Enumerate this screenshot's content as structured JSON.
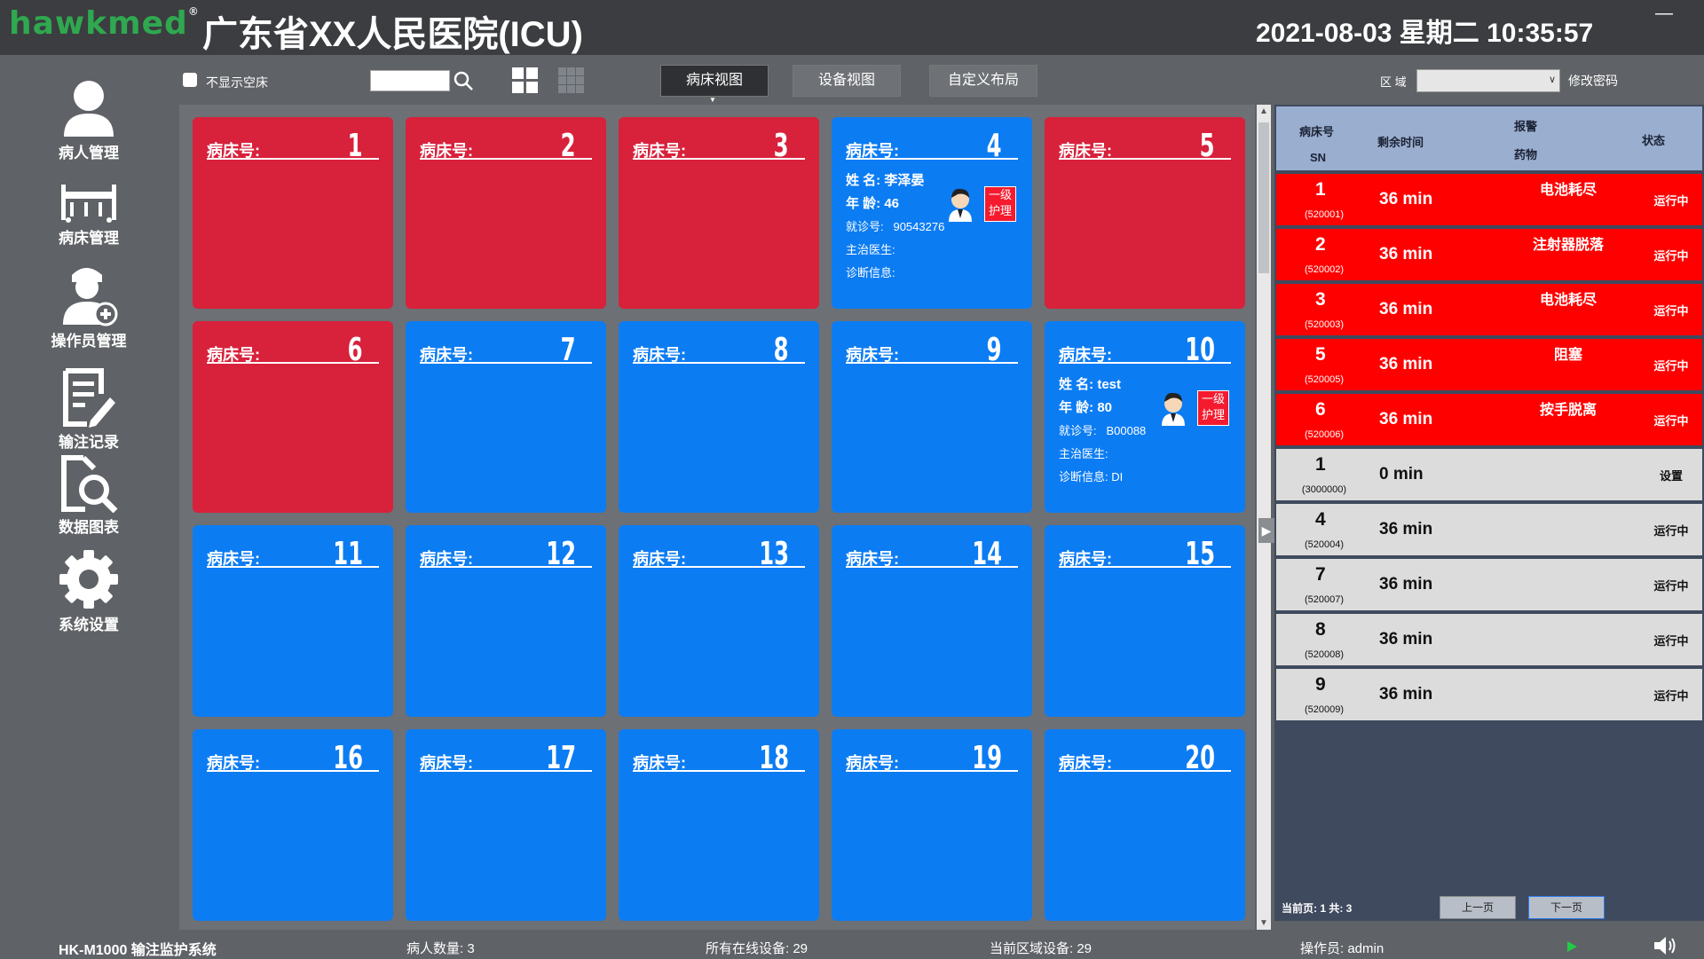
{
  "app": {
    "logo": "hawkmed",
    "title": "广东省XX人民医院(ICU)",
    "datetime": "2021-08-03  星期二  10:35:57"
  },
  "sidebar": {
    "items": [
      {
        "label": "病人管理",
        "icon": "patient-icon"
      },
      {
        "label": "病床管理",
        "icon": "bed-icon"
      },
      {
        "label": "操作员管理",
        "icon": "operator-add-icon"
      },
      {
        "label": "输注记录",
        "icon": "record-edit-icon"
      },
      {
        "label": "数据图表",
        "icon": "data-search-icon"
      },
      {
        "label": "系统设置",
        "icon": "gear-icon"
      }
    ]
  },
  "toolbar": {
    "hide_empty_label": "不显示空床",
    "search_value": "",
    "tabs": [
      "病床视图",
      "设备视图",
      "自定义布局"
    ],
    "area_label": "区 域",
    "area_value": "",
    "change_password": "修改密码"
  },
  "bed_label": "病床号:",
  "beds": [
    {
      "no": "1",
      "color": "red"
    },
    {
      "no": "2",
      "color": "red"
    },
    {
      "no": "3",
      "color": "red"
    },
    {
      "no": "4",
      "color": "blue",
      "name": "李泽晏",
      "age": "46",
      "visit_no": "90543276",
      "doctor": "",
      "diagnosis": "",
      "care": "一级\n护理"
    },
    {
      "no": "5",
      "color": "red"
    },
    {
      "no": "6",
      "color": "red"
    },
    {
      "no": "7",
      "color": "blue"
    },
    {
      "no": "8",
      "color": "blue"
    },
    {
      "no": "9",
      "color": "blue"
    },
    {
      "no": "10",
      "color": "blue",
      "name": "test",
      "age": "80",
      "visit_no": "B00088",
      "doctor": "",
      "diagnosis": "DI",
      "care": "一级\n护理"
    },
    {
      "no": "11",
      "color": "blue"
    },
    {
      "no": "12",
      "color": "blue"
    },
    {
      "no": "13",
      "color": "blue"
    },
    {
      "no": "14",
      "color": "blue"
    },
    {
      "no": "15",
      "color": "blue"
    },
    {
      "no": "16",
      "color": "blue"
    },
    {
      "no": "17",
      "color": "blue"
    },
    {
      "no": "18",
      "color": "blue"
    },
    {
      "no": "19",
      "color": "blue"
    },
    {
      "no": "20",
      "color": "blue"
    }
  ],
  "patient_labels": {
    "name": "姓  名:",
    "age": "年  龄:",
    "visit": "就诊号:",
    "doctor": "主治医生:",
    "diagnosis": "诊断信息:"
  },
  "panel": {
    "headers": {
      "bed": "病床号",
      "sn": "SN",
      "remaining": "剩余时间",
      "alarm": "报警",
      "drug": "药物",
      "status": "状态"
    },
    "rows": [
      {
        "bed": "1",
        "sn": "(520001)",
        "remaining": "36 min",
        "alarm": "电池耗尽",
        "status": "运行中",
        "level": "red"
      },
      {
        "bed": "2",
        "sn": "(520002)",
        "remaining": "36 min",
        "alarm": "注射器脱落",
        "status": "运行中",
        "level": "red"
      },
      {
        "bed": "3",
        "sn": "(520003)",
        "remaining": "36 min",
        "alarm": "电池耗尽",
        "status": "运行中",
        "level": "red"
      },
      {
        "bed": "5",
        "sn": "(520005)",
        "remaining": "36 min",
        "alarm": "阻塞",
        "status": "运行中",
        "level": "red"
      },
      {
        "bed": "6",
        "sn": "(520006)",
        "remaining": "36 min",
        "alarm": "按手脱离",
        "status": "运行中",
        "level": "red"
      },
      {
        "bed": "1",
        "sn": "(3000000)",
        "remaining": "0 min",
        "alarm": "",
        "status": "设置",
        "level": "grey"
      },
      {
        "bed": "4",
        "sn": "(520004)",
        "remaining": "36 min",
        "alarm": "",
        "status": "运行中",
        "level": "grey"
      },
      {
        "bed": "7",
        "sn": "(520007)",
        "remaining": "36 min",
        "alarm": "",
        "status": "运行中",
        "level": "grey"
      },
      {
        "bed": "8",
        "sn": "(520008)",
        "remaining": "36 min",
        "alarm": "",
        "status": "运行中",
        "level": "grey"
      },
      {
        "bed": "9",
        "sn": "(520009)",
        "remaining": "36 min",
        "alarm": "",
        "status": "运行中",
        "level": "grey"
      }
    ],
    "pager_text": "当前页: 1 共: 3",
    "prev": "上一页",
    "next": "下一页"
  },
  "statusbar": {
    "system": "HK-M1000 输注监护系统",
    "patients": "病人数量: 3",
    "online": "所有在线设备: 29",
    "region": "当前区域设备: 29",
    "operator": "操作员: admin"
  },
  "colors": {
    "red": "#d8213b",
    "blue": "#0c7cf3",
    "alarm_red": "#ff0000"
  }
}
